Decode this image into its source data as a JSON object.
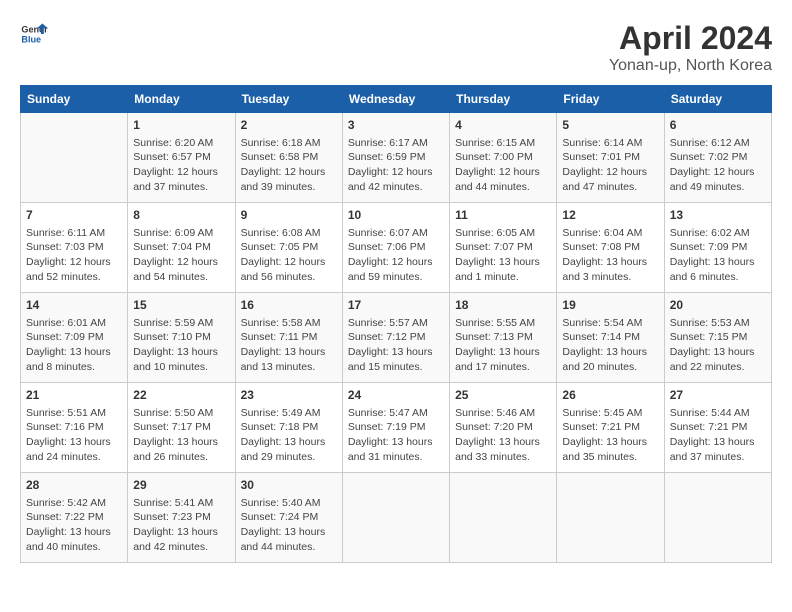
{
  "header": {
    "logo_line1": "General",
    "logo_line2": "Blue",
    "title": "April 2024",
    "subtitle": "Yonan-up, North Korea"
  },
  "days_of_week": [
    "Sunday",
    "Monday",
    "Tuesday",
    "Wednesday",
    "Thursday",
    "Friday",
    "Saturday"
  ],
  "weeks": [
    [
      {
        "day": "",
        "content": ""
      },
      {
        "day": "1",
        "content": "Sunrise: 6:20 AM\nSunset: 6:57 PM\nDaylight: 12 hours\nand 37 minutes."
      },
      {
        "day": "2",
        "content": "Sunrise: 6:18 AM\nSunset: 6:58 PM\nDaylight: 12 hours\nand 39 minutes."
      },
      {
        "day": "3",
        "content": "Sunrise: 6:17 AM\nSunset: 6:59 PM\nDaylight: 12 hours\nand 42 minutes."
      },
      {
        "day": "4",
        "content": "Sunrise: 6:15 AM\nSunset: 7:00 PM\nDaylight: 12 hours\nand 44 minutes."
      },
      {
        "day": "5",
        "content": "Sunrise: 6:14 AM\nSunset: 7:01 PM\nDaylight: 12 hours\nand 47 minutes."
      },
      {
        "day": "6",
        "content": "Sunrise: 6:12 AM\nSunset: 7:02 PM\nDaylight: 12 hours\nand 49 minutes."
      }
    ],
    [
      {
        "day": "7",
        "content": "Sunrise: 6:11 AM\nSunset: 7:03 PM\nDaylight: 12 hours\nand 52 minutes."
      },
      {
        "day": "8",
        "content": "Sunrise: 6:09 AM\nSunset: 7:04 PM\nDaylight: 12 hours\nand 54 minutes."
      },
      {
        "day": "9",
        "content": "Sunrise: 6:08 AM\nSunset: 7:05 PM\nDaylight: 12 hours\nand 56 minutes."
      },
      {
        "day": "10",
        "content": "Sunrise: 6:07 AM\nSunset: 7:06 PM\nDaylight: 12 hours\nand 59 minutes."
      },
      {
        "day": "11",
        "content": "Sunrise: 6:05 AM\nSunset: 7:07 PM\nDaylight: 13 hours\nand 1 minute."
      },
      {
        "day": "12",
        "content": "Sunrise: 6:04 AM\nSunset: 7:08 PM\nDaylight: 13 hours\nand 3 minutes."
      },
      {
        "day": "13",
        "content": "Sunrise: 6:02 AM\nSunset: 7:09 PM\nDaylight: 13 hours\nand 6 minutes."
      }
    ],
    [
      {
        "day": "14",
        "content": "Sunrise: 6:01 AM\nSunset: 7:09 PM\nDaylight: 13 hours\nand 8 minutes."
      },
      {
        "day": "15",
        "content": "Sunrise: 5:59 AM\nSunset: 7:10 PM\nDaylight: 13 hours\nand 10 minutes."
      },
      {
        "day": "16",
        "content": "Sunrise: 5:58 AM\nSunset: 7:11 PM\nDaylight: 13 hours\nand 13 minutes."
      },
      {
        "day": "17",
        "content": "Sunrise: 5:57 AM\nSunset: 7:12 PM\nDaylight: 13 hours\nand 15 minutes."
      },
      {
        "day": "18",
        "content": "Sunrise: 5:55 AM\nSunset: 7:13 PM\nDaylight: 13 hours\nand 17 minutes."
      },
      {
        "day": "19",
        "content": "Sunrise: 5:54 AM\nSunset: 7:14 PM\nDaylight: 13 hours\nand 20 minutes."
      },
      {
        "day": "20",
        "content": "Sunrise: 5:53 AM\nSunset: 7:15 PM\nDaylight: 13 hours\nand 22 minutes."
      }
    ],
    [
      {
        "day": "21",
        "content": "Sunrise: 5:51 AM\nSunset: 7:16 PM\nDaylight: 13 hours\nand 24 minutes."
      },
      {
        "day": "22",
        "content": "Sunrise: 5:50 AM\nSunset: 7:17 PM\nDaylight: 13 hours\nand 26 minutes."
      },
      {
        "day": "23",
        "content": "Sunrise: 5:49 AM\nSunset: 7:18 PM\nDaylight: 13 hours\nand 29 minutes."
      },
      {
        "day": "24",
        "content": "Sunrise: 5:47 AM\nSunset: 7:19 PM\nDaylight: 13 hours\nand 31 minutes."
      },
      {
        "day": "25",
        "content": "Sunrise: 5:46 AM\nSunset: 7:20 PM\nDaylight: 13 hours\nand 33 minutes."
      },
      {
        "day": "26",
        "content": "Sunrise: 5:45 AM\nSunset: 7:21 PM\nDaylight: 13 hours\nand 35 minutes."
      },
      {
        "day": "27",
        "content": "Sunrise: 5:44 AM\nSunset: 7:21 PM\nDaylight: 13 hours\nand 37 minutes."
      }
    ],
    [
      {
        "day": "28",
        "content": "Sunrise: 5:42 AM\nSunset: 7:22 PM\nDaylight: 13 hours\nand 40 minutes."
      },
      {
        "day": "29",
        "content": "Sunrise: 5:41 AM\nSunset: 7:23 PM\nDaylight: 13 hours\nand 42 minutes."
      },
      {
        "day": "30",
        "content": "Sunrise: 5:40 AM\nSunset: 7:24 PM\nDaylight: 13 hours\nand 44 minutes."
      },
      {
        "day": "",
        "content": ""
      },
      {
        "day": "",
        "content": ""
      },
      {
        "day": "",
        "content": ""
      },
      {
        "day": "",
        "content": ""
      }
    ]
  ]
}
